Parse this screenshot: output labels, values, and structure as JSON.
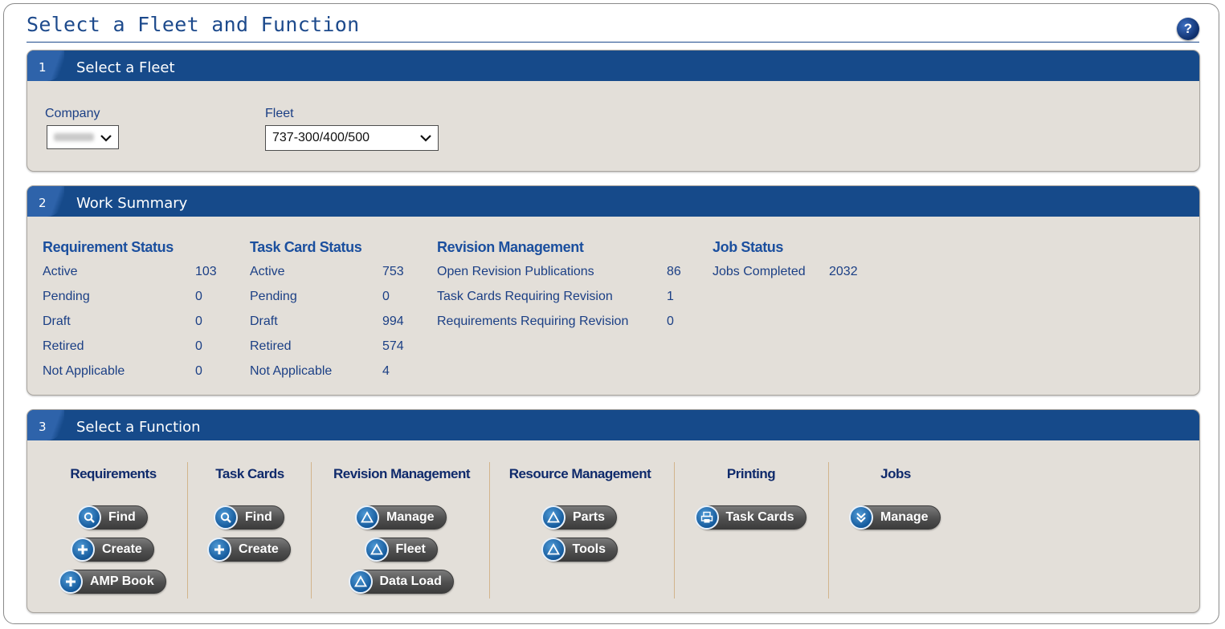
{
  "page": {
    "title": "Select a Fleet and Function",
    "help_icon": "question-icon",
    "help_label": "?"
  },
  "fleet_panel": {
    "number": "1",
    "title": "Select a Fleet",
    "company_label": "Company",
    "company_value": "",
    "fleet_label": "Fleet",
    "fleet_value": "737-300/400/500"
  },
  "work_summary": {
    "number": "2",
    "title": "Work Summary",
    "requirement_status": {
      "heading": "Requirement Status",
      "rows": [
        {
          "label": "Active",
          "value": "103"
        },
        {
          "label": "Pending",
          "value": "0"
        },
        {
          "label": "Draft",
          "value": "0"
        },
        {
          "label": "Retired",
          "value": "0"
        },
        {
          "label": "Not Applicable",
          "value": "0"
        }
      ]
    },
    "task_card_status": {
      "heading": "Task Card Status",
      "rows": [
        {
          "label": "Active",
          "value": "753"
        },
        {
          "label": "Pending",
          "value": "0"
        },
        {
          "label": "Draft",
          "value": "994"
        },
        {
          "label": "Retired",
          "value": "574"
        },
        {
          "label": "Not Applicable",
          "value": "4"
        }
      ]
    },
    "revision_management": {
      "heading": "Revision Management",
      "rows": [
        {
          "label": "Open Revision Publications",
          "value": "86"
        },
        {
          "label": "Task Cards Requiring Revision",
          "value": "1"
        },
        {
          "label": "Requirements Requiring Revision",
          "value": "0"
        }
      ]
    },
    "job_status": {
      "heading": "Job Status",
      "rows": [
        {
          "label": "Jobs Completed",
          "value": "2032"
        }
      ]
    }
  },
  "functions": {
    "number": "3",
    "title": "Select a Function",
    "groups": [
      {
        "heading": "Requirements",
        "buttons": [
          {
            "label": "Find",
            "icon": "search-icon"
          },
          {
            "label": "Create",
            "icon": "plus-icon"
          },
          {
            "label": "AMP Book",
            "icon": "plus-icon"
          }
        ]
      },
      {
        "heading": "Task Cards",
        "buttons": [
          {
            "label": "Find",
            "icon": "search-icon"
          },
          {
            "label": "Create",
            "icon": "plus-icon"
          }
        ]
      },
      {
        "heading": "Revision Management",
        "buttons": [
          {
            "label": "Manage",
            "icon": "triangle-icon"
          },
          {
            "label": "Fleet",
            "icon": "triangle-icon"
          },
          {
            "label": "Data Load",
            "icon": "triangle-icon"
          }
        ]
      },
      {
        "heading": "Resource Management",
        "buttons": [
          {
            "label": "Parts",
            "icon": "triangle-icon"
          },
          {
            "label": "Tools",
            "icon": "triangle-icon"
          }
        ]
      },
      {
        "heading": "Printing",
        "buttons": [
          {
            "label": "Task Cards",
            "icon": "printer-icon"
          }
        ]
      },
      {
        "heading": "Jobs",
        "buttons": [
          {
            "label": "Manage",
            "icon": "arrow-down-icon"
          }
        ]
      }
    ]
  }
}
